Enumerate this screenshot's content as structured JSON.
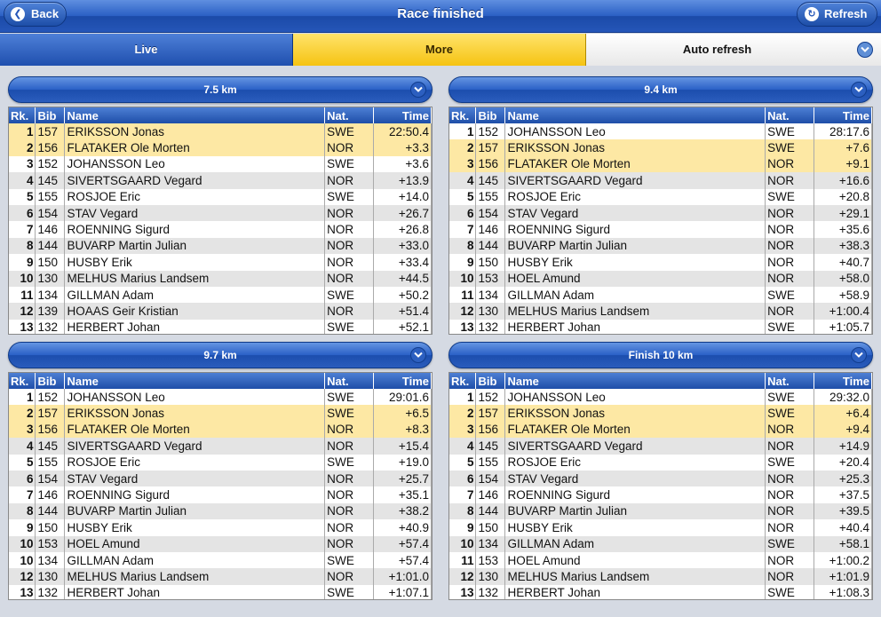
{
  "header": {
    "title": "Race finished",
    "back_label": "Back",
    "refresh_label": "Refresh"
  },
  "tabs": {
    "live": "Live",
    "more": "More",
    "auto_refresh": "Auto refresh"
  },
  "columns": {
    "rank": "Rk.",
    "bib": "Bib",
    "name": "Name",
    "nat": "Nat.",
    "time": "Time"
  },
  "colors": {
    "accent_blue": "#2556b8",
    "highlight_yellow": "#fde8a4",
    "tab_yellow": "#f5c312"
  },
  "panels": [
    {
      "title": "7.5 km",
      "rows": [
        {
          "rk": "1",
          "bib": "157",
          "name": "ERIKSSON Jonas",
          "nat": "SWE",
          "time": "22:50.4",
          "hl": true
        },
        {
          "rk": "2",
          "bib": "156",
          "name": "FLATAKER Ole Morten",
          "nat": "NOR",
          "time": "+3.3",
          "hl": true
        },
        {
          "rk": "3",
          "bib": "152",
          "name": "JOHANSSON Leo",
          "nat": "SWE",
          "time": "+3.6",
          "hl": false
        },
        {
          "rk": "4",
          "bib": "145",
          "name": "SIVERTSGAARD Vegard",
          "nat": "NOR",
          "time": "+13.9",
          "hl": false
        },
        {
          "rk": "5",
          "bib": "155",
          "name": "ROSJOE Eric",
          "nat": "SWE",
          "time": "+14.0",
          "hl": false
        },
        {
          "rk": "6",
          "bib": "154",
          "name": "STAV Vegard",
          "nat": "NOR",
          "time": "+26.7",
          "hl": false
        },
        {
          "rk": "7",
          "bib": "146",
          "name": "ROENNING Sigurd",
          "nat": "NOR",
          "time": "+26.8",
          "hl": false
        },
        {
          "rk": "8",
          "bib": "144",
          "name": "BUVARP Martin Julian",
          "nat": "NOR",
          "time": "+33.0",
          "hl": false
        },
        {
          "rk": "9",
          "bib": "150",
          "name": "HUSBY Erik",
          "nat": "NOR",
          "time": "+33.4",
          "hl": false
        },
        {
          "rk": "10",
          "bib": "130",
          "name": "MELHUS Marius Landsem",
          "nat": "NOR",
          "time": "+44.5",
          "hl": false
        },
        {
          "rk": "11",
          "bib": "134",
          "name": "GILLMAN Adam",
          "nat": "SWE",
          "time": "+50.2",
          "hl": false
        },
        {
          "rk": "12",
          "bib": "139",
          "name": "HOAAS Geir Kristian",
          "nat": "NOR",
          "time": "+51.4",
          "hl": false
        },
        {
          "rk": "13",
          "bib": "132",
          "name": "HERBERT Johan",
          "nat": "SWE",
          "time": "+52.1",
          "hl": false
        }
      ]
    },
    {
      "title": "9.4 km",
      "rows": [
        {
          "rk": "1",
          "bib": "152",
          "name": "JOHANSSON Leo",
          "nat": "SWE",
          "time": "28:17.6",
          "hl": false
        },
        {
          "rk": "2",
          "bib": "157",
          "name": "ERIKSSON Jonas",
          "nat": "SWE",
          "time": "+7.6",
          "hl": true
        },
        {
          "rk": "3",
          "bib": "156",
          "name": "FLATAKER Ole Morten",
          "nat": "NOR",
          "time": "+9.1",
          "hl": true
        },
        {
          "rk": "4",
          "bib": "145",
          "name": "SIVERTSGAARD Vegard",
          "nat": "NOR",
          "time": "+16.6",
          "hl": false
        },
        {
          "rk": "5",
          "bib": "155",
          "name": "ROSJOE Eric",
          "nat": "SWE",
          "time": "+20.8",
          "hl": false
        },
        {
          "rk": "6",
          "bib": "154",
          "name": "STAV Vegard",
          "nat": "NOR",
          "time": "+29.1",
          "hl": false
        },
        {
          "rk": "7",
          "bib": "146",
          "name": "ROENNING Sigurd",
          "nat": "NOR",
          "time": "+35.6",
          "hl": false
        },
        {
          "rk": "8",
          "bib": "144",
          "name": "BUVARP Martin Julian",
          "nat": "NOR",
          "time": "+38.3",
          "hl": false
        },
        {
          "rk": "9",
          "bib": "150",
          "name": "HUSBY Erik",
          "nat": "NOR",
          "time": "+40.7",
          "hl": false
        },
        {
          "rk": "10",
          "bib": "153",
          "name": "HOEL Amund",
          "nat": "NOR",
          "time": "+58.0",
          "hl": false
        },
        {
          "rk": "11",
          "bib": "134",
          "name": "GILLMAN Adam",
          "nat": "SWE",
          "time": "+58.9",
          "hl": false
        },
        {
          "rk": "12",
          "bib": "130",
          "name": "MELHUS Marius Landsem",
          "nat": "NOR",
          "time": "+1:00.4",
          "hl": false
        },
        {
          "rk": "13",
          "bib": "132",
          "name": "HERBERT Johan",
          "nat": "SWE",
          "time": "+1:05.7",
          "hl": false
        }
      ]
    },
    {
      "title": "9.7 km",
      "rows": [
        {
          "rk": "1",
          "bib": "152",
          "name": "JOHANSSON Leo",
          "nat": "SWE",
          "time": "29:01.6",
          "hl": false
        },
        {
          "rk": "2",
          "bib": "157",
          "name": "ERIKSSON Jonas",
          "nat": "SWE",
          "time": "+6.5",
          "hl": true
        },
        {
          "rk": "3",
          "bib": "156",
          "name": "FLATAKER Ole Morten",
          "nat": "NOR",
          "time": "+8.3",
          "hl": true
        },
        {
          "rk": "4",
          "bib": "145",
          "name": "SIVERTSGAARD Vegard",
          "nat": "NOR",
          "time": "+15.4",
          "hl": false
        },
        {
          "rk": "5",
          "bib": "155",
          "name": "ROSJOE Eric",
          "nat": "SWE",
          "time": "+19.0",
          "hl": false
        },
        {
          "rk": "6",
          "bib": "154",
          "name": "STAV Vegard",
          "nat": "NOR",
          "time": "+25.7",
          "hl": false
        },
        {
          "rk": "7",
          "bib": "146",
          "name": "ROENNING Sigurd",
          "nat": "NOR",
          "time": "+35.1",
          "hl": false
        },
        {
          "rk": "8",
          "bib": "144",
          "name": "BUVARP Martin Julian",
          "nat": "NOR",
          "time": "+38.2",
          "hl": false
        },
        {
          "rk": "9",
          "bib": "150",
          "name": "HUSBY Erik",
          "nat": "NOR",
          "time": "+40.9",
          "hl": false
        },
        {
          "rk": "10",
          "bib": "153",
          "name": "HOEL Amund",
          "nat": "NOR",
          "time": "+57.4",
          "hl": false
        },
        {
          "rk": "10",
          "bib": "134",
          "name": "GILLMAN Adam",
          "nat": "SWE",
          "time": "+57.4",
          "hl": false
        },
        {
          "rk": "12",
          "bib": "130",
          "name": "MELHUS Marius Landsem",
          "nat": "NOR",
          "time": "+1:01.0",
          "hl": false
        },
        {
          "rk": "13",
          "bib": "132",
          "name": "HERBERT Johan",
          "nat": "SWE",
          "time": "+1:07.1",
          "hl": false
        }
      ]
    },
    {
      "title": "Finish 10 km",
      "rows": [
        {
          "rk": "1",
          "bib": "152",
          "name": "JOHANSSON Leo",
          "nat": "SWE",
          "time": "29:32.0",
          "hl": false
        },
        {
          "rk": "2",
          "bib": "157",
          "name": "ERIKSSON Jonas",
          "nat": "SWE",
          "time": "+6.4",
          "hl": true
        },
        {
          "rk": "3",
          "bib": "156",
          "name": "FLATAKER Ole Morten",
          "nat": "NOR",
          "time": "+9.4",
          "hl": true
        },
        {
          "rk": "4",
          "bib": "145",
          "name": "SIVERTSGAARD Vegard",
          "nat": "NOR",
          "time": "+14.9",
          "hl": false
        },
        {
          "rk": "5",
          "bib": "155",
          "name": "ROSJOE Eric",
          "nat": "SWE",
          "time": "+20.4",
          "hl": false
        },
        {
          "rk": "6",
          "bib": "154",
          "name": "STAV Vegard",
          "nat": "NOR",
          "time": "+25.3",
          "hl": false
        },
        {
          "rk": "7",
          "bib": "146",
          "name": "ROENNING Sigurd",
          "nat": "NOR",
          "time": "+37.5",
          "hl": false
        },
        {
          "rk": "8",
          "bib": "144",
          "name": "BUVARP Martin Julian",
          "nat": "NOR",
          "time": "+39.5",
          "hl": false
        },
        {
          "rk": "9",
          "bib": "150",
          "name": "HUSBY Erik",
          "nat": "NOR",
          "time": "+40.4",
          "hl": false
        },
        {
          "rk": "10",
          "bib": "134",
          "name": "GILLMAN Adam",
          "nat": "SWE",
          "time": "+58.1",
          "hl": false
        },
        {
          "rk": "11",
          "bib": "153",
          "name": "HOEL Amund",
          "nat": "NOR",
          "time": "+1:00.2",
          "hl": false
        },
        {
          "rk": "12",
          "bib": "130",
          "name": "MELHUS Marius Landsem",
          "nat": "NOR",
          "time": "+1:01.9",
          "hl": false
        },
        {
          "rk": "13",
          "bib": "132",
          "name": "HERBERT Johan",
          "nat": "SWE",
          "time": "+1:08.3",
          "hl": false
        }
      ]
    }
  ]
}
